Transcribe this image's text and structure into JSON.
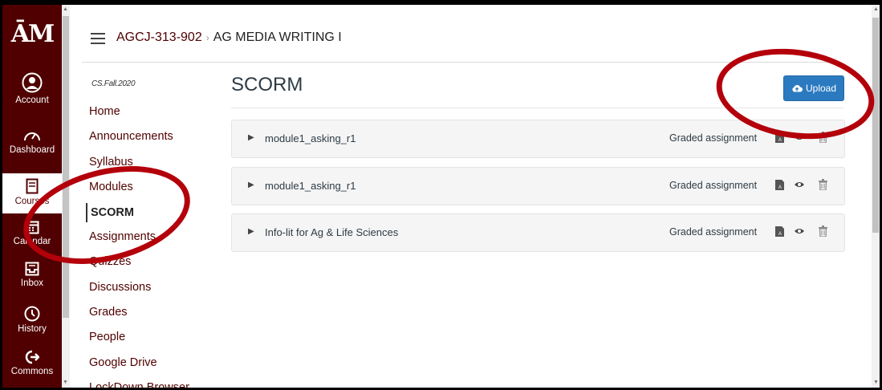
{
  "global_nav": {
    "logo_text": "ĀM",
    "items": [
      {
        "label": "Account",
        "icon": "account-icon"
      },
      {
        "label": "Dashboard",
        "icon": "dashboard-icon"
      },
      {
        "label": "Courses",
        "icon": "courses-icon"
      },
      {
        "label": "Calendar",
        "icon": "calendar-icon"
      },
      {
        "label": "Inbox",
        "icon": "inbox-icon"
      },
      {
        "label": "History",
        "icon": "history-icon"
      },
      {
        "label": "Commons",
        "icon": "commons-icon"
      }
    ]
  },
  "breadcrumb": {
    "course": "AGCJ-313-902",
    "separator": "›",
    "current": "AG MEDIA WRITING I"
  },
  "course_menu": {
    "term": "CS.Fall.2020",
    "items": [
      "Home",
      "Announcements",
      "Syllabus",
      "Modules",
      "SCORM",
      "Assignments",
      "Quizzes",
      "Discussions",
      "Grades",
      "People",
      "Google Drive",
      "LockDown Browser"
    ],
    "active": "SCORM"
  },
  "main": {
    "title": "SCORM",
    "upload_label": "Upload",
    "packages": [
      {
        "name": "module1_asking_r1",
        "kind": "Graded assignment"
      },
      {
        "name": "module1_asking_r1",
        "kind": "Graded assignment"
      },
      {
        "name": "Info-lit for Ag & Life Sciences",
        "kind": "Graded assignment"
      }
    ]
  },
  "colors": {
    "brand": "#500000",
    "button": "#2b7ac0",
    "annotation": "#b3000a"
  }
}
